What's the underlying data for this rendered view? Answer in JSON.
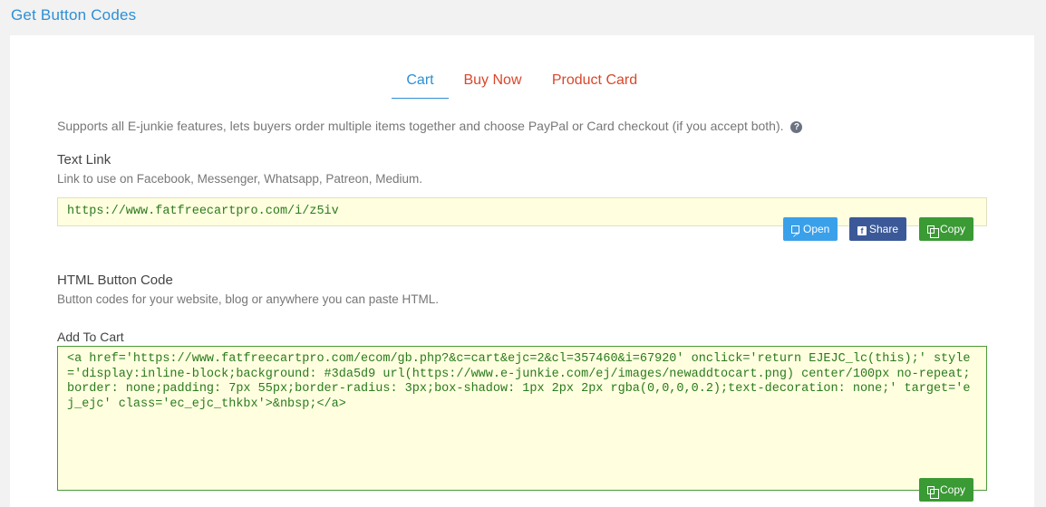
{
  "page": {
    "title": "Get Button Codes"
  },
  "tabs": [
    {
      "label": "Cart",
      "active": true
    },
    {
      "label": "Buy Now",
      "active": false
    },
    {
      "label": "Product Card",
      "active": false
    }
  ],
  "description": "Supports all E-junkie features, lets buyers order multiple items together and choose PayPal or Card checkout (if you accept both).",
  "help_icon": "?",
  "text_link": {
    "title": "Text Link",
    "subtitle": "Link to use on Facebook, Messenger, Whatsapp, Patreon, Medium.",
    "url": "https://www.fatfreecartpro.com/i/z5iv",
    "buttons": {
      "open": "Open",
      "share": "Share",
      "copy": "Copy"
    }
  },
  "html_code": {
    "title": "HTML Button Code",
    "subtitle": "Button codes for your website, blog or anywhere you can paste HTML.",
    "label": "Add To Cart",
    "code": "<a href='https://www.fatfreecartpro.com/ecom/gb.php?&c=cart&ejc=2&cl=357460&i=67920' onclick='return EJEJC_lc(this);' style='display:inline-block;background: #3da5d9 url(https://www.e-junkie.com/ej/images/newaddtocart.png) center/100px no-repeat;border: none;padding: 7px 55px;border-radius: 3px;box-shadow: 1px 2px 2px rgba(0,0,0,0.2);text-decoration: none;' target='ej_ejc' class='ec_ejc_thkbx'>&nbsp;</a>",
    "copy": "Copy"
  },
  "colors": {
    "accent_blue": "#2d8fd5",
    "tab_inactive": "#d9472b",
    "copy_green": "#3a9a34",
    "facebook": "#3b5998",
    "field_bg": "#ffffe0"
  }
}
